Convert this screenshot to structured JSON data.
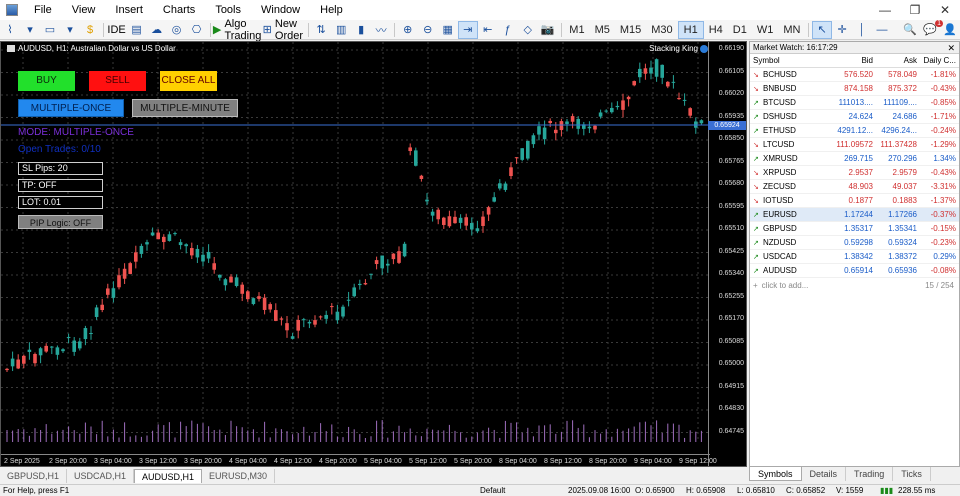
{
  "menu": {
    "items": [
      "File",
      "View",
      "Insert",
      "Charts",
      "Tools",
      "Window",
      "Help"
    ],
    "window_controls": [
      "—",
      "❐",
      "✕"
    ]
  },
  "toolbar": {
    "ide_label": "IDE",
    "algo_trading_label": "Algo Trading",
    "new_order_label": "New Order",
    "timeframes": [
      "M1",
      "M5",
      "M15",
      "M30",
      "H1",
      "H4",
      "D1",
      "W1",
      "MN"
    ],
    "active_timeframe": "H1",
    "notification_count": "1"
  },
  "chart": {
    "title": "AUDUSD, H1: Australian Dollar vs US Dollar",
    "indicator_name": "Stacking King",
    "current_price_label": "0.65924",
    "price_ticks": [
      "0.66190",
      "0.66105",
      "0.66020",
      "0.65935",
      "0.65850",
      "0.65765",
      "0.65680",
      "0.65595",
      "0.65510",
      "0.65425",
      "0.65340",
      "0.65255",
      "0.65170",
      "0.65085",
      "0.65000",
      "0.64915",
      "0.64830",
      "0.64745"
    ],
    "time_ticks": [
      "2 Sep 2025",
      "2 Sep 20:00",
      "3 Sep 04:00",
      "3 Sep 12:00",
      "3 Sep 20:00",
      "4 Sep 04:00",
      "4 Sep 12:00",
      "4 Sep 20:00",
      "5 Sep 04:00",
      "5 Sep 12:00",
      "5 Sep 20:00",
      "8 Sep 04:00",
      "8 Sep 12:00",
      "8 Sep 20:00",
      "9 Sep 04:00",
      "9 Sep 12:00"
    ],
    "colors": {
      "bull": "#26a69a",
      "bear": "#ef5350",
      "background": "#000000",
      "grid": "#3a3a3a",
      "volume": "#a070c0",
      "price_line": "#3a6fd4"
    }
  },
  "ea_panel": {
    "buy_label": "BUY",
    "sell_label": "SELL",
    "close_all_label": "CLOSE ALL",
    "mode_once_label": "MULTIPLE-ONCE",
    "mode_minute_label": "MULTIPLE-MINUTE",
    "mode_text": "MODE: MULTIPLE-ONCE",
    "open_trades_text": "Open Trades: 0/10",
    "sl_pips": "SL Pips: 20",
    "tp": "TP: OFF",
    "lot": "LOT: 0.01",
    "pip_logic": "PIP Logic: OFF"
  },
  "chart_tabs": [
    {
      "label": "GBPUSD,H1",
      "active": false
    },
    {
      "label": "USDCAD,H1",
      "active": false
    },
    {
      "label": "AUDUSD,H1",
      "active": true
    },
    {
      "label": "EURUSD,M30",
      "active": false
    }
  ],
  "status_bar": {
    "help": "For Help, press F1",
    "profile": "Default",
    "time": "2025.09.08 16:00",
    "open": "O: 0.65900",
    "high": "H: 0.65908",
    "low": "L: 0.65810",
    "close": "C: 0.65852",
    "volume": "V: 1559",
    "traffic": "228.55 ms"
  },
  "market_watch": {
    "title": "Market Watch: 16:17:29",
    "columns": [
      "Symbol",
      "Bid",
      "Ask",
      "Daily C..."
    ],
    "rows": [
      {
        "symbol": "BCHUSD",
        "bid": "576.520",
        "ask": "578.049",
        "change": "-1.81%",
        "dir": "down"
      },
      {
        "symbol": "BNBUSD",
        "bid": "874.158",
        "ask": "875.372",
        "change": "-0.43%",
        "dir": "down"
      },
      {
        "symbol": "BTCUSD",
        "bid": "111013....",
        "ask": "111109....",
        "change": "-0.85%",
        "dir": "up"
      },
      {
        "symbol": "DSHUSD",
        "bid": "24.624",
        "ask": "24.686",
        "change": "-1.71%",
        "dir": "up"
      },
      {
        "symbol": "ETHUSD",
        "bid": "4291.12...",
        "ask": "4296.24...",
        "change": "-0.24%",
        "dir": "up"
      },
      {
        "symbol": "LTCUSD",
        "bid": "111.09572",
        "ask": "111.37428",
        "change": "-1.29%",
        "dir": "down"
      },
      {
        "symbol": "XMRUSD",
        "bid": "269.715",
        "ask": "270.296",
        "change": "1.34%",
        "dir": "up"
      },
      {
        "symbol": "XRPUSD",
        "bid": "2.9537",
        "ask": "2.9579",
        "change": "-0.43%",
        "dir": "down"
      },
      {
        "symbol": "ZECUSD",
        "bid": "48.903",
        "ask": "49.037",
        "change": "-3.31%",
        "dir": "down"
      },
      {
        "symbol": "IOTUSD",
        "bid": "0.1877",
        "ask": "0.1883",
        "change": "-1.37%",
        "dir": "down"
      },
      {
        "symbol": "EURUSD",
        "bid": "1.17244",
        "ask": "1.17266",
        "change": "-0.37%",
        "dir": "up"
      },
      {
        "symbol": "GBPUSD",
        "bid": "1.35317",
        "ask": "1.35341",
        "change": "-0.15%",
        "dir": "up"
      },
      {
        "symbol": "NZDUSD",
        "bid": "0.59298",
        "ask": "0.59324",
        "change": "-0.23%",
        "dir": "up"
      },
      {
        "symbol": "USDCAD",
        "bid": "1.38342",
        "ask": "1.38372",
        "change": "0.29%",
        "dir": "up"
      },
      {
        "symbol": "AUDUSD",
        "bid": "0.65914",
        "ask": "0.65936",
        "change": "-0.08%",
        "dir": "up"
      }
    ],
    "add_label": "click to add...",
    "count": "15 / 254",
    "tabs": [
      "Symbols",
      "Details",
      "Trading",
      "Ticks"
    ]
  }
}
